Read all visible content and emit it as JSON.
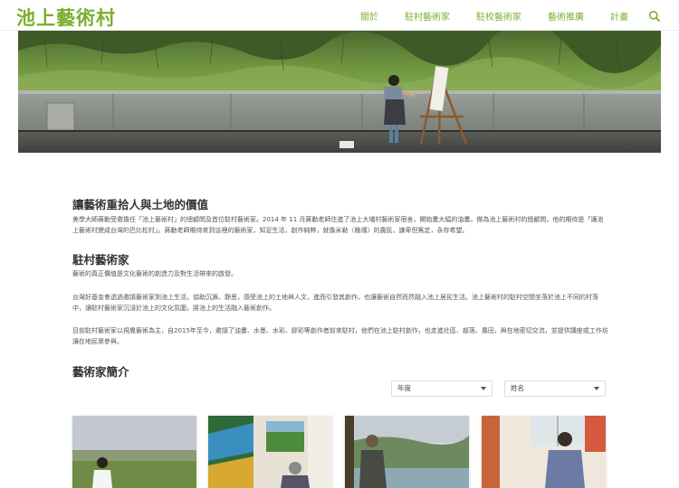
{
  "header": {
    "logo": "池上藝術村",
    "nav": [
      "關於",
      "駐村藝術家",
      "駐校藝術家",
      "藝術推廣",
      "計畫"
    ],
    "search_icon": "search-icon"
  },
  "sections": {
    "values": {
      "title": "讓藝術重拾人與土地的價值",
      "paragraph": "美學大師蔣勳受邀擔任「池上藝術村」的總顧問及首位駐村藝術家。2014 年 11 月蔣勳老師住進了池上大埔村藝術家宿舍，開始畫大幅的油畫。做為池上藝術村的總顧問，他的期待是「讓池上藝術村變成台灣的巴比松村」。蔣勳老師期待來到這裡的藝術家，知足生活，創作純粹，就像米勒〈晚禱〉的農民，謙卑但篤定，永存希望。"
    },
    "residency": {
      "title": "駐村藝術家",
      "p1": "藝術的真正價值是文化藝術的創造力及對生活帶來的啟發。",
      "p2": "台灣好基金會透過邀請藝術家到池上生活，協助沉澱、靜思，感受池上的土地與人文，進而引發其創作。也讓藝術自然而然融入池上居民生活。池上藝術村的駐村空間坐落於池上不同的村落中，讓駐村藝術家沉浸於池上的文化氛圍，將池上的生活融入藝術創作。",
      "p3": "目前駐村藝術家以視覺藝術為主，自2015年至今，邀請了油畫、水墨、水彩、膠彩等創作者前來駐村，他們在池上駐村創作，也走進社區、部落、農田，與在地密切交流，並提供講座或工作坊讓在地民眾參與。"
    },
    "intro": {
      "title": "藝術家簡介"
    }
  },
  "filters": {
    "year": "年度",
    "name": "姓名"
  },
  "colors": {
    "brand": "#7ab030"
  }
}
